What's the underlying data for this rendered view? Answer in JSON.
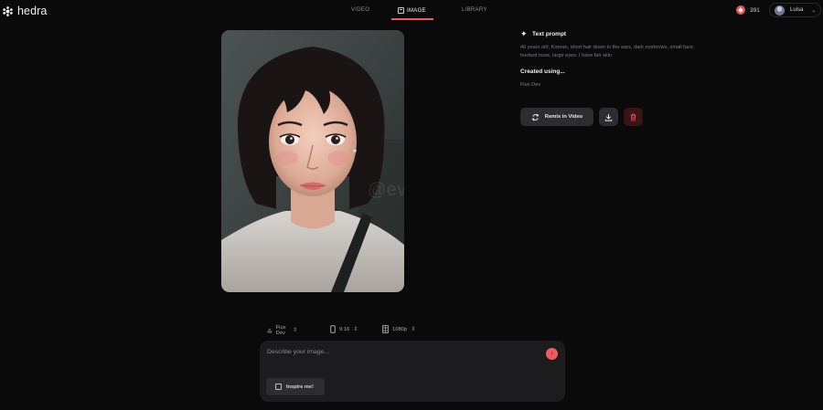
{
  "app": {
    "name": "hedra"
  },
  "nav": {
    "tabs": [
      {
        "label": "VIDEO"
      },
      {
        "label": "IMAGE"
      },
      {
        "label": "LIBRARY"
      }
    ],
    "active": "IMAGE"
  },
  "header": {
    "credits": "391",
    "user": "Luisa"
  },
  "image": {
    "watermark": "@eviltwin"
  },
  "details": {
    "prompt_heading": "Text prompt",
    "prompt_text": "40 years old, Korean, short hair down to the ears, dark eyebrows, small face, hooked nose, large eyes. I have fair skin",
    "created_heading": "Created using...",
    "model": "Flux Dev",
    "remix_label": "Remix in Video"
  },
  "toolbar": {
    "model": "Flux Dev",
    "aspect": "9:16",
    "resolution": "1080p"
  },
  "composer": {
    "placeholder": "Describe your image...",
    "inspire_label": "Inspire me!"
  },
  "colors": {
    "accent": "#f25a5f",
    "background": "#0a0a0b",
    "surface": "#1c1c1f",
    "button": "#2d2d31",
    "danger": "#3a1518"
  },
  "icons": [
    "hedra-logo-icon",
    "image-icon",
    "credit-icon",
    "chevron-down-icon",
    "sparkle-icon",
    "remix-icon",
    "download-icon",
    "trash-icon",
    "model-icon",
    "aspect-icon",
    "resolution-icon",
    "send-icon",
    "dice-icon"
  ]
}
